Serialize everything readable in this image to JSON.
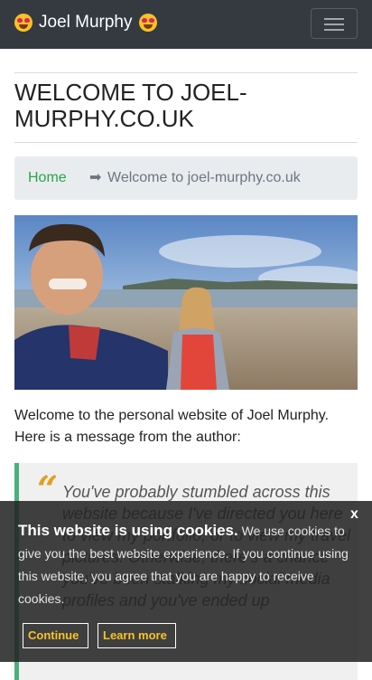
{
  "header": {
    "brand": "Joel Murphy",
    "left_emoji_icon": "heart-eyes-emoji-icon",
    "right_emoji_icon": "heart-eyes-emoji-icon",
    "menu_icon": "hamburger-menu-icon"
  },
  "page": {
    "title": "WELCOME TO JOEL-MURPHY.CO.UK"
  },
  "breadcrumb": {
    "home": "Home",
    "separator": "➡",
    "current": "Welcome to joel-murphy.co.uk"
  },
  "intro": "Welcome to the personal website of Joel Murphy. Here is a message from the author:",
  "quote": {
    "mark": "“",
    "text": "You've probably stumbled across this website because I've directed you here to view my portfolio, or to view my travel pictures. Otherwise, there's a chance you've been stalking my social media profiles and you've ended up"
  },
  "cookie_banner": {
    "title": "This website is using cookies.",
    "message": "We use cookies to give you the best website experience. If you continue using this website, you agree that you are happy to receive cookies.",
    "continue_label": "Continue",
    "learn_more_label": "Learn more",
    "close_label": "x"
  },
  "colors": {
    "navbar": "#343a40",
    "link_green": "#28a745",
    "quote_border": "#4caf7d",
    "cookie_button_text": "#f7c325"
  }
}
